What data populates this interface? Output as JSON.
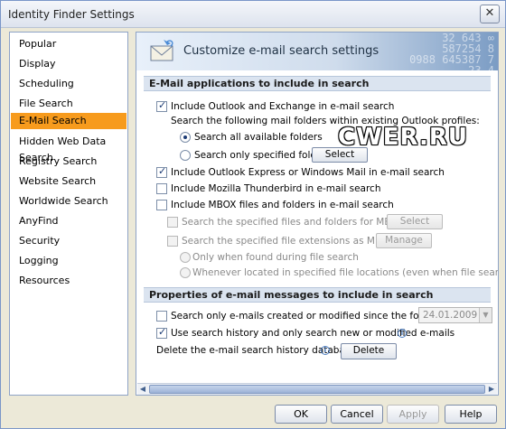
{
  "window": {
    "title": "Identity Finder Settings"
  },
  "nav": {
    "items": [
      "Popular",
      "Display",
      "Scheduling",
      "File Search",
      "E-Mail Search",
      "Hidden Web Data Search",
      "Registry Search",
      "Website Search",
      "Worldwide Search",
      "AnyFind",
      "Security",
      "Logging",
      "Resources"
    ],
    "active": "E-Mail Search"
  },
  "header": {
    "title": "Customize e-mail search settings",
    "deco_digits": "32 643 ∞\n587254 8\n0988 645387 7\n23 4"
  },
  "section1": {
    "title": "E-Mail applications to include in search",
    "outlook": "Include Outlook and Exchange in e-mail search",
    "outlook_sub": "Search the following mail folders within existing Outlook profiles:",
    "radio_all": "Search all available folders",
    "radio_specified": "Search only specified folders:",
    "select_button": "Select",
    "outlook_express": "Include Outlook Express or Windows Mail in e-mail search",
    "thunderbird": "Include Mozilla Thunderbird in e-mail search",
    "mbox": "Include MBOX files and folders in e-mail search",
    "mbox_specified": "Search the specified files and folders for MBOX files:",
    "mbox_select": "Select",
    "mbox_extensions": "Search the specified file extensions as MBOX files:",
    "mbox_manage": "Manage",
    "radio_only_found": "Only when found during file search",
    "radio_whenever": "Whenever located in specified file locations (even when file search off)"
  },
  "section2": {
    "title": "Properties of e-mail messages to include in search",
    "since_date": "Search only e-mails created or modified since the following date:",
    "date_value": "24.01.2009",
    "use_history": "Use search history and only search new or modified e-mails",
    "delete_label": "Delete the e-mail search history database:",
    "delete_button": "Delete"
  },
  "footer": {
    "ok": "OK",
    "cancel": "Cancel",
    "apply": "Apply",
    "help": "Help"
  },
  "watermark": {
    "text": "CWER.RU"
  }
}
